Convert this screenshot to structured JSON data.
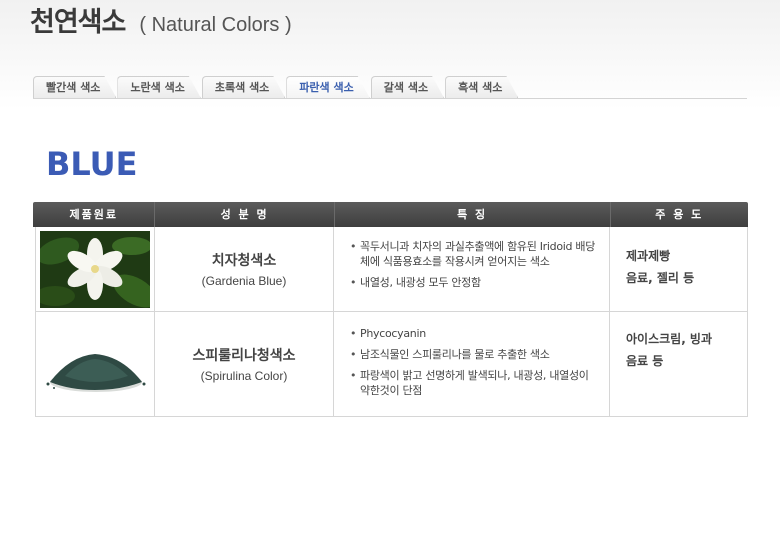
{
  "header": {
    "title_ko": "천연색소",
    "title_en": "( Natural Colors )"
  },
  "tabs": [
    {
      "label": "빨간색 색소",
      "active": false
    },
    {
      "label": "노란색 색소",
      "active": false
    },
    {
      "label": "초록색 색소",
      "active": false
    },
    {
      "label": "파란색 색소",
      "active": true
    },
    {
      "label": "갈색 색소",
      "active": false
    },
    {
      "label": "흑색 색소",
      "active": false
    }
  ],
  "section_title": "BLUE",
  "table": {
    "headers": [
      "제품원료",
      "성 분 명",
      "특    징",
      "주 용 도"
    ],
    "rows": [
      {
        "image": "gardenia-flower-photo",
        "name_ko": "치자청색소",
        "name_en": "(Gardenia Blue)",
        "features": [
          "꼭두서니과 치자의 과실추출액에 함유된 Iridoid 배당체에 식품용효소를 작용시켜 얻어지는 색소",
          "내열성, 내광성 모두 안정함"
        ],
        "uses": [
          "제과제빵",
          "음료, 젤리 등"
        ]
      },
      {
        "image": "spirulina-powder-photo",
        "name_ko": "스피룰리나청색소",
        "name_en": "(Spirulina Color)",
        "features": [
          "Phycocyanin",
          "남조식물인 스피룰리나를 물로 추출한 색소",
          "파랑색이 밝고 선명하게 발색되나, 내광성, 내열성이 약한것이 단점"
        ],
        "uses": [
          "아이스크림, 빙과",
          "음료 등"
        ]
      }
    ]
  },
  "colors": {
    "accent_blue": "#3b5bb5",
    "header_dark": "#444444",
    "active_tab": "#3a5fae"
  }
}
